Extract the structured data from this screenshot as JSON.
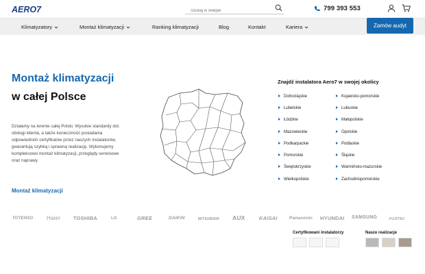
{
  "header": {
    "logo_text": "AERO7",
    "search_placeholder": "Szukaj w sklepie",
    "phone": "799 393 553"
  },
  "nav": {
    "items": [
      {
        "label": "Klimatyzatory",
        "dropdown": true
      },
      {
        "label": "Montaż klimatyzacji",
        "dropdown": true
      },
      {
        "label": "Ranking klimatyzacji",
        "dropdown": false
      },
      {
        "label": "Blog",
        "dropdown": false
      },
      {
        "label": "Kontakt",
        "dropdown": false
      },
      {
        "label": "Kariera",
        "dropdown": true
      }
    ],
    "cta_label": "Zamów audyt"
  },
  "hero": {
    "title_line1": "Montaż klimatyzacji",
    "title_line2": "w całej Polsce",
    "description": "Działamy na terenie całej Polski. Wysokie standardy dot. obsługi klienta, a także konieczność posiadania odpowiednich certyfikatów przez naszych instalatorów, gwarantują szybką i sprawną realizację. Wykonujemy kompleksowo montaż klimatyzacji, przeglądy serwisowe oraz naprawy.",
    "link": "Montaż klimatyzacji"
  },
  "installers": {
    "title": "Znajdź instalatora Aero7 w swojej okolicy",
    "regions_left": [
      "Dolnośląskie",
      "Lubelskie",
      "Łódzkie",
      "Mazowieckie",
      "Podkarpackie",
      "Pomorskie",
      "Świętokrzyskie",
      "Wielkopolskie"
    ],
    "regions_right": [
      "Kujawsko-pomorskie",
      "Lubuskie",
      "Małopolskie",
      "Opolskie",
      "Podlaskie",
      "Śląskie",
      "Warmińsko-mazurskie",
      "Zachodniopomorskie"
    ]
  },
  "brands": [
    "TOTENSO",
    "Haier",
    "TOSHIBA",
    "LG",
    "GREE",
    "DAIKIN",
    "MITSUBISHI",
    "AUX",
    "KAISAI",
    "Panasonic",
    "HYUNDAI",
    "SAMSUNG",
    "FUJITSU"
  ],
  "certs": {
    "installers_title": "Certyfikowani instalatorzy",
    "realizations_title": "Nasze realizacje"
  },
  "colors": {
    "accent": "#1568b0",
    "nav_bg": "#efefef"
  }
}
